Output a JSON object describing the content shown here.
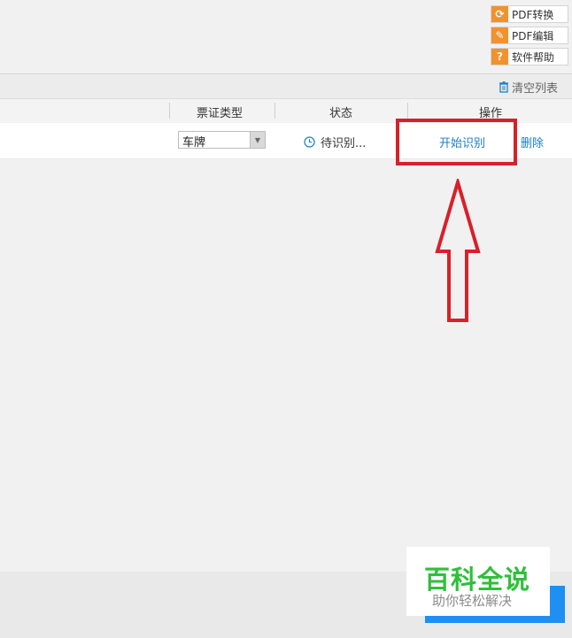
{
  "tools": [
    {
      "label": "PDF转换",
      "icon": "refresh-icon",
      "glyph": "⟳"
    },
    {
      "label": "PDF编辑",
      "icon": "pencil-icon",
      "glyph": "✎"
    },
    {
      "label": "软件帮助",
      "icon": "question-icon",
      "glyph": "?"
    }
  ],
  "toolbar": {
    "clear_list": "清空列表",
    "clear_icon": "trash-icon"
  },
  "table": {
    "headers": {
      "type": "票证类型",
      "status": "状态",
      "action": "操作"
    },
    "row": {
      "type_value": "车牌",
      "status_text": "待识别...",
      "start_label": "开始识别",
      "delete_label": "删除"
    }
  },
  "watermark": {
    "title": "百科全说",
    "subtitle": "助你轻松解决"
  },
  "colors": {
    "accent": "#1c80c4",
    "highlight": "#d8202a",
    "tool_icon": "#f0922e",
    "button": "#1e8ff3"
  }
}
